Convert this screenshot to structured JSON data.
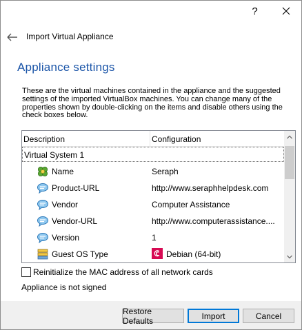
{
  "titlebar": {
    "help_label": "?",
    "close_label": "×"
  },
  "header": {
    "title": "Import Virtual Appliance"
  },
  "page": {
    "heading": "Appliance settings",
    "description": "These are the virtual machines contained in the appliance and the suggested settings of the imported VirtualBox machines. You can change many of the properties shown by double-clicking on the items and disable others using the check boxes below."
  },
  "tree": {
    "columns": [
      "Description",
      "Configuration"
    ],
    "system_label": "Virtual System 1",
    "rows": [
      {
        "label": "Name",
        "value": "Seraph",
        "icon": "vm-name-icon"
      },
      {
        "label": "Product-URL",
        "value": "http://www.seraphhelpdesk.com",
        "icon": "speech-bubble-icon"
      },
      {
        "label": "Vendor",
        "value": "Computer Assistance",
        "icon": "speech-bubble-icon"
      },
      {
        "label": "Vendor-URL",
        "value": "http://www.computerassistance....",
        "icon": "speech-bubble-icon"
      },
      {
        "label": "Version",
        "value": "1",
        "icon": "speech-bubble-icon"
      },
      {
        "label": "Guest OS Type",
        "value": "Debian (64-bit)",
        "icon": "os-type-icon",
        "value_icon": "debian-logo-icon"
      }
    ]
  },
  "options": {
    "reinit_mac_label": "Reinitialize the MAC address of all network cards",
    "reinit_mac_checked": false
  },
  "status": {
    "signed": "Appliance is not signed"
  },
  "buttons": {
    "restore": "Restore Defaults",
    "import": "Import",
    "cancel": "Cancel"
  },
  "colors": {
    "heading": "#1b55a8",
    "default_button_border": "#0078d7"
  }
}
